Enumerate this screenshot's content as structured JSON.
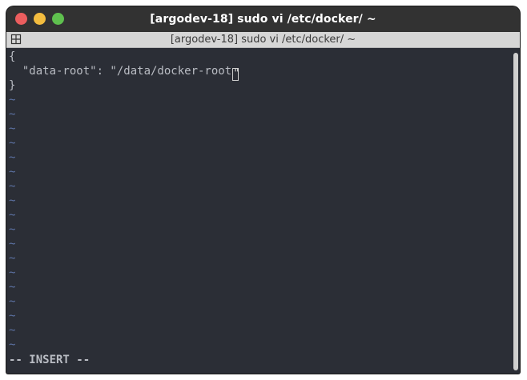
{
  "window": {
    "title": "[argodev-18] sudo vi /etc/docker/ ~",
    "tab_title": "[argodev-18] sudo vi /etc/docker/ ~",
    "controls": [
      "close-icon",
      "minimize-icon",
      "maximize-icon"
    ],
    "colors": {
      "close": "#ec5e5e",
      "minimize": "#f4bd3f",
      "maximize": "#5fc04e",
      "editor_bg": "#2b2e36",
      "tilde": "#5d73a5"
    }
  },
  "editor": {
    "lines": [
      "{",
      "  \"data-root\": \"/data/docker-root",
      "}"
    ],
    "cursor_char": "\"",
    "tilde": "~",
    "tilde_count": 18,
    "mode": "-- INSERT --"
  }
}
